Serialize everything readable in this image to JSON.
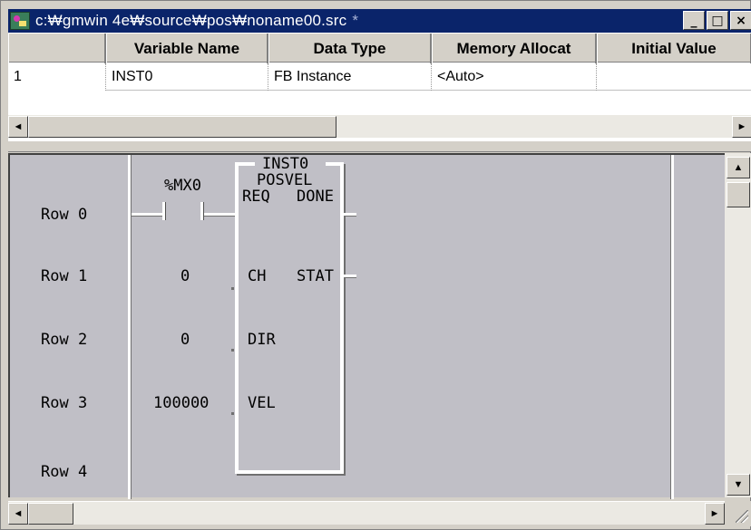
{
  "window": {
    "title": "c:₩gmwin 4e₩source₩pos₩noname00.src",
    "modified_marker": "*",
    "buttons": {
      "minimize": "_",
      "maximize": "□",
      "close": "×"
    }
  },
  "grid": {
    "columns": [
      "Variable Name",
      "Data Type",
      "Memory Allocat",
      "Initial Value"
    ],
    "rows": [
      {
        "num": "1",
        "name": "INST0",
        "type": "FB Instance",
        "memory": "<Auto>",
        "initial": ""
      }
    ]
  },
  "ladder": {
    "row_labels": [
      "Row 0",
      "Row 1",
      "Row 2",
      "Row 3",
      "Row 4"
    ],
    "contact_label": "%MX0",
    "fb": {
      "instance": "INST0",
      "type": "POSVEL",
      "inputs": [
        "REQ",
        "CH",
        "DIR",
        "VEL"
      ],
      "outputs": [
        "DONE",
        "STAT"
      ]
    },
    "input_values": {
      "ch": "0",
      "dir": "0",
      "vel": "100000"
    }
  },
  "scroll": {
    "left_arrow": "◄",
    "right_arrow": "►",
    "up_arrow": "▲",
    "down_arrow": "▼"
  }
}
